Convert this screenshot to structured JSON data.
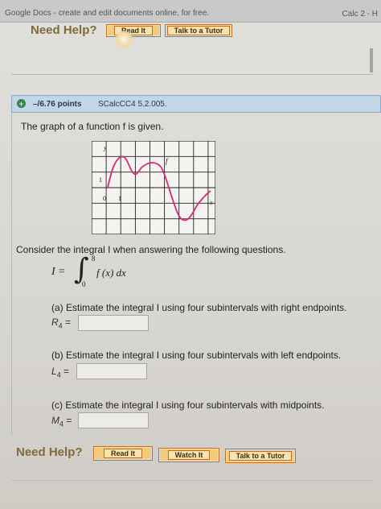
{
  "browser": {
    "tab_title": "Google Docs - create and edit documents online, for free.",
    "tab_right": "Calc 2 - H"
  },
  "help_top": {
    "label": "Need Help?",
    "read_it": "Read It",
    "talk_tutor": "Talk to a Tutor"
  },
  "question": {
    "points": "–/6.76 points",
    "source": "SCalcCC4 5.2.005.",
    "prompt": "The graph of a function f is given.",
    "graph": {
      "y_label": "y",
      "x_label": "x",
      "f_label": "f",
      "tick_1_y": "1",
      "origin": "0",
      "tick_1_x": "1"
    },
    "consider": "Consider the integral I when answering the following questions.",
    "integral": {
      "lhs": "I =",
      "upper": "8",
      "lower": "0",
      "integrand": "f (x) dx"
    },
    "parts": [
      {
        "text": "(a) Estimate the integral I using four subintervals with right endpoints.",
        "label": "R",
        "sub": "4",
        "eq": "=",
        "value": ""
      },
      {
        "text": "(b) Estimate the integral I using four subintervals with left endpoints.",
        "label": "L",
        "sub": "4",
        "eq": "=",
        "value": ""
      },
      {
        "text": "(c) Estimate the integral I using four subintervals with midpoints.",
        "label": "M",
        "sub": "4",
        "eq": "=",
        "value": ""
      }
    ]
  },
  "help_bottom": {
    "label": "Need Help?",
    "read_it": "Read It",
    "watch_it": "Watch It",
    "talk_tutor": "Talk to a Tutor"
  }
}
